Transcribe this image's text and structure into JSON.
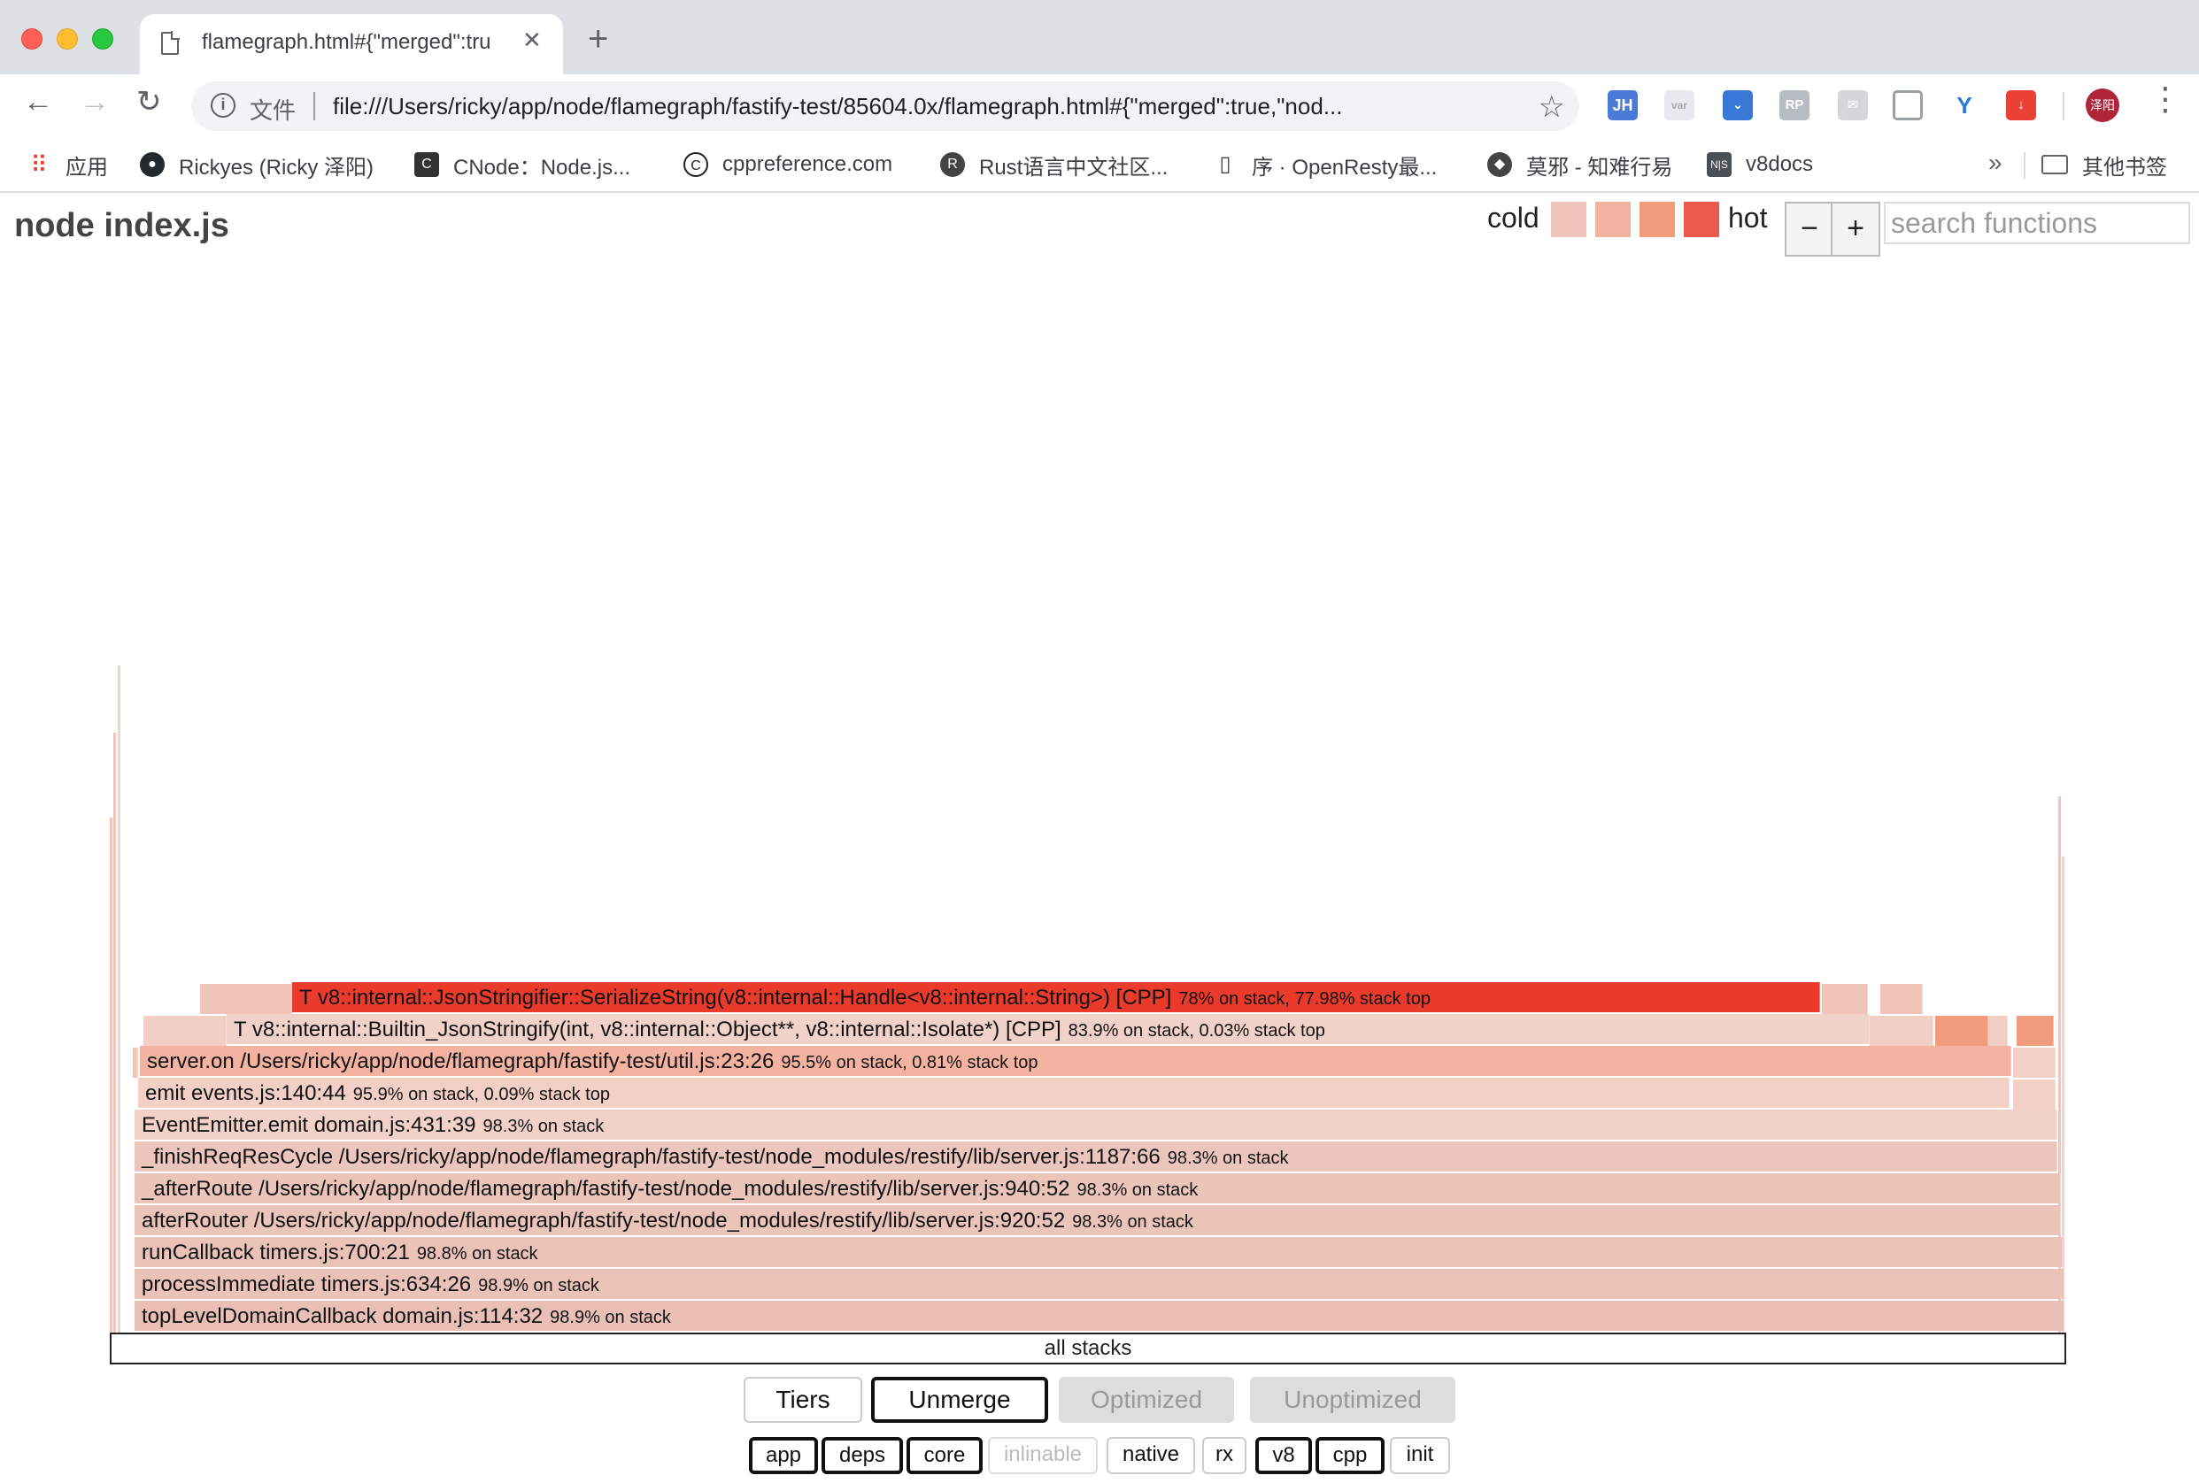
{
  "browser": {
    "tab_title": "flamegraph.html#{\"merged\":tru",
    "url_label": "文件",
    "url": "file:///Users/ricky/app/node/flamegraph/fastify-test/85604.0x/flamegraph.html#{\"merged\":true,\"nod...",
    "extensions": [
      "JH",
      "var",
      "RP"
    ],
    "avatar": "泽阳",
    "bookmarks": [
      {
        "label": "应用",
        "icon": "apps-grid-icon"
      },
      {
        "label": "Rickyes (Ricky 泽阳)",
        "icon": "github-icon"
      },
      {
        "label": "CNode：Node.js...",
        "icon": "cnode-icon"
      },
      {
        "label": "cppreference.com",
        "icon": "cppreference-icon"
      },
      {
        "label": "Rust语言中文社区...",
        "icon": "rust-icon"
      },
      {
        "label": "序 · OpenResty最...",
        "icon": "book-icon"
      },
      {
        "label": "莫邪 - 知难行易",
        "icon": "cat-icon"
      },
      {
        "label": "v8docs",
        "icon": "ns-icon"
      }
    ],
    "bookmarks_more": "»",
    "other_bookmarks": "其他书签"
  },
  "page": {
    "title": "node index.js",
    "legend_cold": "cold",
    "legend_hot": "hot",
    "heat_colors": [
      "#efc4ba",
      "#f1b29f",
      "#f09b7b",
      "#ec5a4c"
    ],
    "zoom_out": "−",
    "zoom_in": "+",
    "search_placeholder": "search functions"
  },
  "flamegraph": {
    "root_label": "all stacks",
    "frames": [
      {
        "name": "topLevelDomainCallback domain.js:114:32",
        "stats": "98.9% on stack",
        "color": "#eac0b6"
      },
      {
        "name": "processImmediate timers.js:634:26",
        "stats": "98.9% on stack",
        "color": "#eac2b8"
      },
      {
        "name": "runCallback timers.js:700:21",
        "stats": "98.8% on stack",
        "color": "#eac2b8"
      },
      {
        "name": "afterRouter /Users/ricky/app/node/flamegraph/fastify-test/node_modules/restify/lib/server.js:920:52",
        "stats": "98.3% on stack",
        "color": "#ebc4ba"
      },
      {
        "name": "_afterRoute /Users/ricky/app/node/flamegraph/fastify-test/node_modules/restify/lib/server.js:940:52",
        "stats": "98.3% on stack",
        "color": "#ebc4ba"
      },
      {
        "name": "_finishReqResCycle /Users/ricky/app/node/flamegraph/fastify-test/node_modules/restify/lib/server.js:1187:66",
        "stats": "98.3% on stack",
        "color": "#ecc6bc"
      },
      {
        "name": "EventEmitter.emit domain.js:431:39",
        "stats": "98.3% on stack",
        "color": "#f2d2c8"
      },
      {
        "name": "emit events.js:140:44",
        "stats": "95.9% on stack, 0.09% stack top",
        "color": "#f2d0c6"
      },
      {
        "name": "server.on /Users/ricky/app/node/flamegraph/fastify-test/util.js:23:26",
        "stats": "95.5% on stack, 0.81% stack top",
        "color": "#f4b3a1"
      },
      {
        "name": "T v8::internal::Builtin_JsonStringify(int, v8::internal::Object**, v8::internal::Isolate*) [CPP]",
        "stats": "83.9% on stack, 0.03% stack top",
        "color": "#f1d2c8"
      },
      {
        "name": "T v8::internal::JsonStringifier::SerializeString(v8::internal::Handle<v8::internal::String>) [CPP]",
        "stats": "78% on stack, 77.98% stack top",
        "color": "#ea3a2c"
      }
    ]
  },
  "controls": {
    "tiers": [
      {
        "label": "Tiers",
        "state": "on"
      },
      {
        "label": "Unmerge",
        "state": "active"
      },
      {
        "label": "Optimized",
        "state": "off"
      },
      {
        "label": "Unoptimized",
        "state": "off"
      }
    ],
    "filters": [
      {
        "label": "app",
        "state": "on"
      },
      {
        "label": "deps",
        "state": "on"
      },
      {
        "label": "core",
        "state": "on"
      },
      {
        "label": "inlinable",
        "state": "dim"
      },
      {
        "label": "native",
        "state": "plain"
      },
      {
        "label": "rx",
        "state": "plain"
      },
      {
        "label": "v8",
        "state": "on"
      },
      {
        "label": "cpp",
        "state": "on"
      },
      {
        "label": "init",
        "state": "plain"
      }
    ]
  }
}
